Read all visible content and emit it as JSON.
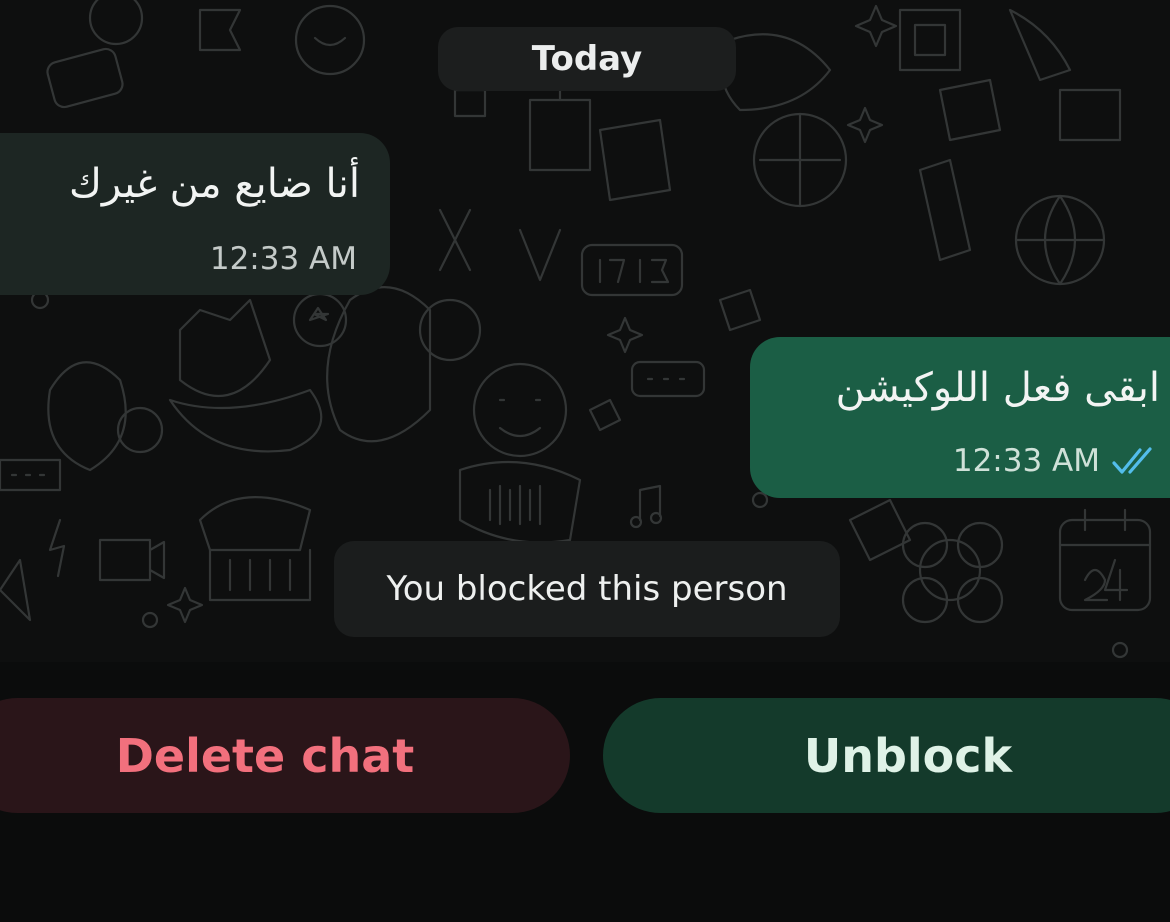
{
  "date_chip": {
    "label": "Today"
  },
  "messages": [
    {
      "direction": "incoming",
      "text": "أنا ضايع من غيرك",
      "time": "12:33 AM"
    },
    {
      "direction": "outgoing",
      "text": "ابقى فعل اللوكيشن",
      "time": "12:33 AM",
      "status_icon": "double-check-read-icon"
    }
  ],
  "system_notice": {
    "text": "You blocked this person"
  },
  "actions": {
    "delete_label": "Delete chat",
    "unblock_label": "Unblock"
  },
  "colors": {
    "background": "#0b0c0c",
    "incoming_bubble": "#1d2623",
    "outgoing_bubble": "#1b5e45",
    "read_ticks": "#53bdeb",
    "delete_text": "#f2707d",
    "delete_button": "#2a1519",
    "unblock_button": "#143a2b"
  }
}
